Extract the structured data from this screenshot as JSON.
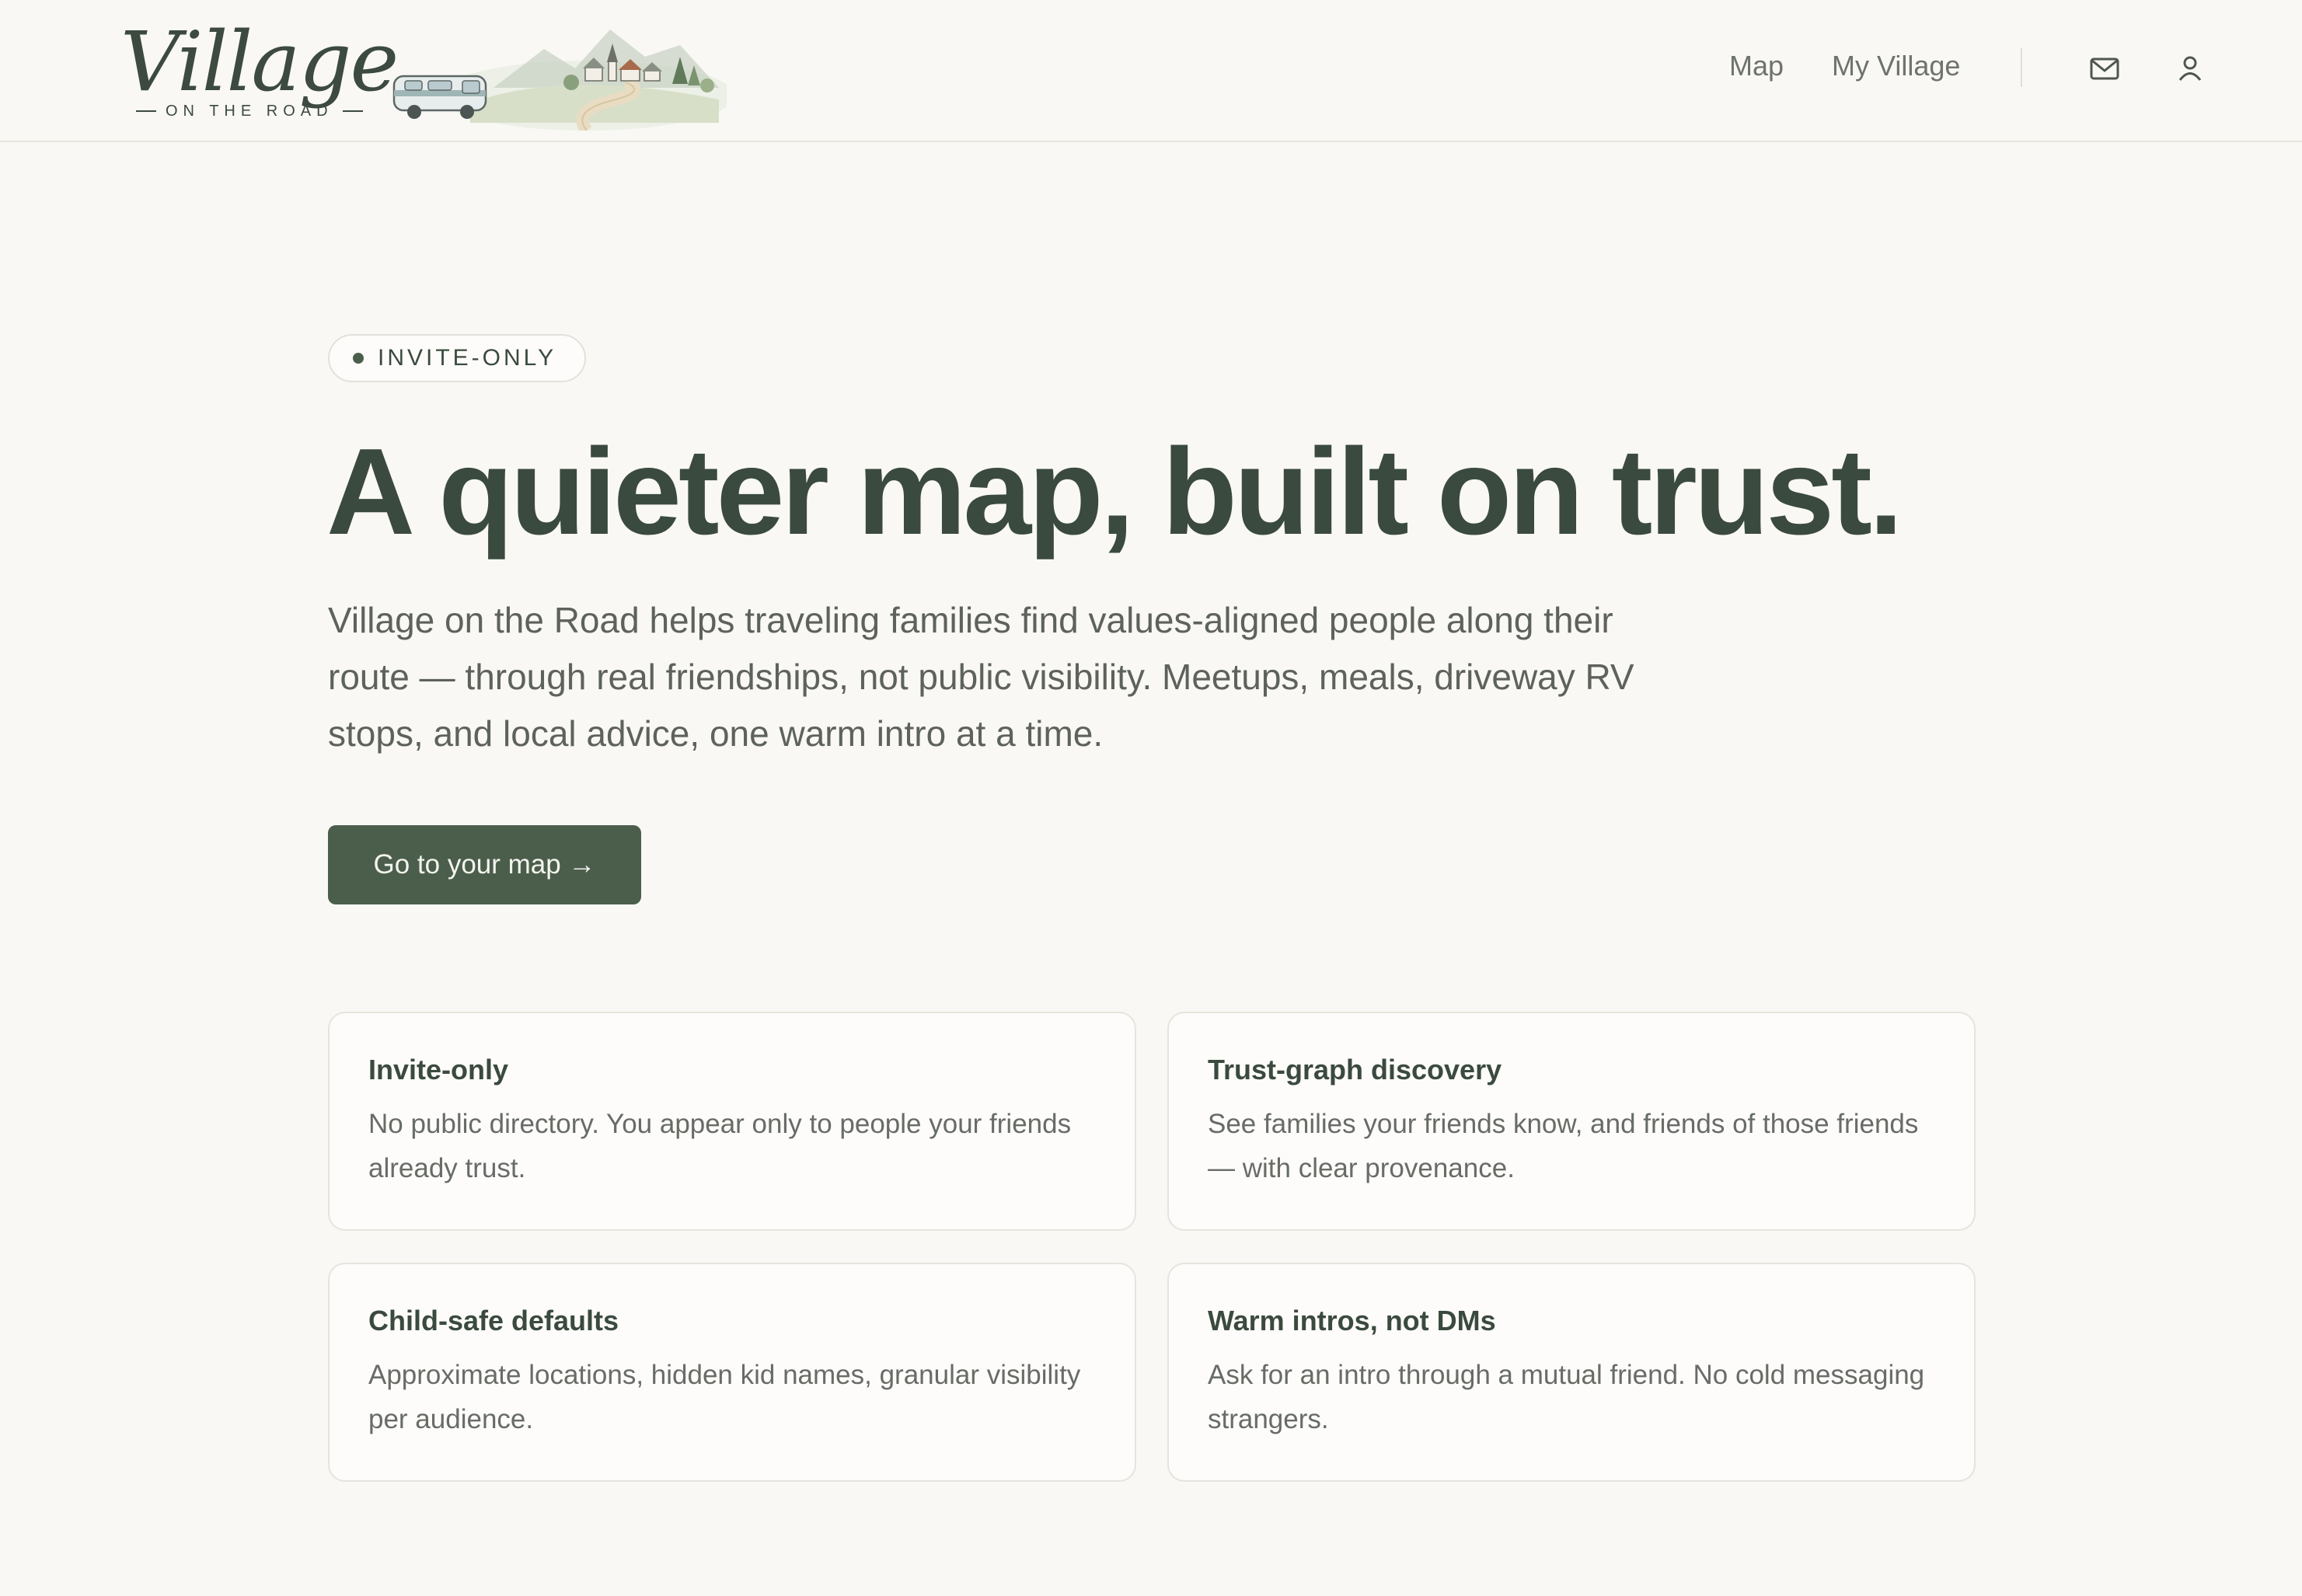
{
  "brand": {
    "wordmark": "Village",
    "tagline": "ON THE ROAD"
  },
  "nav": {
    "links": [
      {
        "label": "Map"
      },
      {
        "label": "My Village"
      }
    ],
    "icons": [
      "mail-icon",
      "user-icon"
    ]
  },
  "hero": {
    "badge": "INVITE-ONLY",
    "title": "A quieter map, built on trust.",
    "subtitle": "Village on the Road helps traveling families find values-aligned people along their route — through real friendships, not public visibility. Meetups, meals, driveway RV stops, and local advice, one warm intro at a time.",
    "cta_label": "Go to your map →"
  },
  "features": [
    {
      "title": "Invite-only",
      "body": "No public directory. You appear only to people your friends already trust."
    },
    {
      "title": "Trust-graph discovery",
      "body": "See families your friends know, and friends of those friends — with clear provenance."
    },
    {
      "title": "Child-safe defaults",
      "body": "Approximate locations, hidden kid names, granular visibility per audience."
    },
    {
      "title": "Warm intros, not DMs",
      "body": "Ask for an intro through a mutual friend. No cold messaging strangers."
    }
  ],
  "colors": {
    "background": "#f9f8f4",
    "primary": "#4b5e4b",
    "text": "#3b4a3e",
    "muted": "#686c66"
  }
}
